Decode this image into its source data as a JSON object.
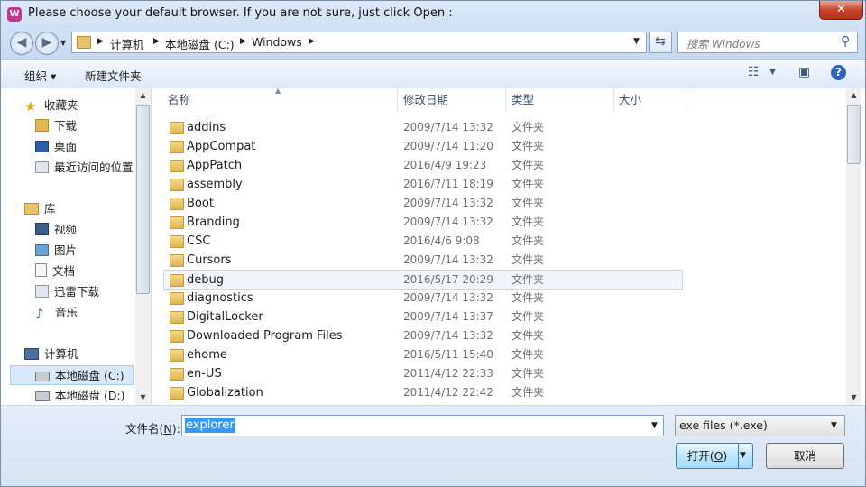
{
  "window": {
    "title": "Please choose your default browser. If you are not sure, just click Open :",
    "close_label": "✕"
  },
  "address": {
    "crumbs": [
      "计算机",
      "本地磁盘 (C:)",
      "Windows"
    ],
    "search_placeholder": "搜索 Windows"
  },
  "toolbar": {
    "organize_label": "组织 ▾",
    "new_folder_label": "新建文件夹",
    "help_label": "?"
  },
  "sidebar": {
    "favorites": {
      "label": "收藏夹",
      "items": [
        "下载",
        "桌面",
        "最近访问的位置"
      ]
    },
    "libraries": {
      "label": "库",
      "items": [
        "视频",
        "图片",
        "文档",
        "迅雷下载",
        "音乐"
      ]
    },
    "computer": {
      "label": "计算机",
      "items": [
        "本地磁盘 (C:)",
        "本地磁盘 (D:)"
      ]
    },
    "selected_item": "本地磁盘 (C:)"
  },
  "file_list": {
    "columns": [
      "名称",
      "修改日期",
      "类型",
      "大小"
    ],
    "hovered_row": "debug",
    "rows": [
      {
        "name": "addins",
        "date": "2009/7/14 13:32",
        "type": "文件夹"
      },
      {
        "name": "AppCompat",
        "date": "2009/7/14 11:20",
        "type": "文件夹"
      },
      {
        "name": "AppPatch",
        "date": "2016/4/9 19:23",
        "type": "文件夹"
      },
      {
        "name": "assembly",
        "date": "2016/7/11 18:19",
        "type": "文件夹"
      },
      {
        "name": "Boot",
        "date": "2009/7/14 13:32",
        "type": "文件夹"
      },
      {
        "name": "Branding",
        "date": "2009/7/14 13:32",
        "type": "文件夹"
      },
      {
        "name": "CSC",
        "date": "2016/4/6 9:08",
        "type": "文件夹"
      },
      {
        "name": "Cursors",
        "date": "2009/7/14 13:32",
        "type": "文件夹"
      },
      {
        "name": "debug",
        "date": "2016/5/17 20:29",
        "type": "文件夹"
      },
      {
        "name": "diagnostics",
        "date": "2009/7/14 13:32",
        "type": "文件夹"
      },
      {
        "name": "DigitalLocker",
        "date": "2009/7/14 13:37",
        "type": "文件夹"
      },
      {
        "name": "Downloaded Program Files",
        "date": "2009/7/14 13:32",
        "type": "文件夹"
      },
      {
        "name": "ehome",
        "date": "2016/5/11 15:40",
        "type": "文件夹"
      },
      {
        "name": "en-US",
        "date": "2011/4/12 22:33",
        "type": "文件夹"
      },
      {
        "name": "Globalization",
        "date": "2011/4/12 22:42",
        "type": "文件夹"
      }
    ]
  },
  "bottom": {
    "filename_label": "文件名(",
    "filename_hotkey": "N",
    "filename_label_end": "):",
    "filename_value": "explorer",
    "filetype_value": "exe files (*.exe)",
    "open_label": "打开(",
    "open_hotkey": "O",
    "open_label_end": ")",
    "cancel_label": "取消"
  }
}
